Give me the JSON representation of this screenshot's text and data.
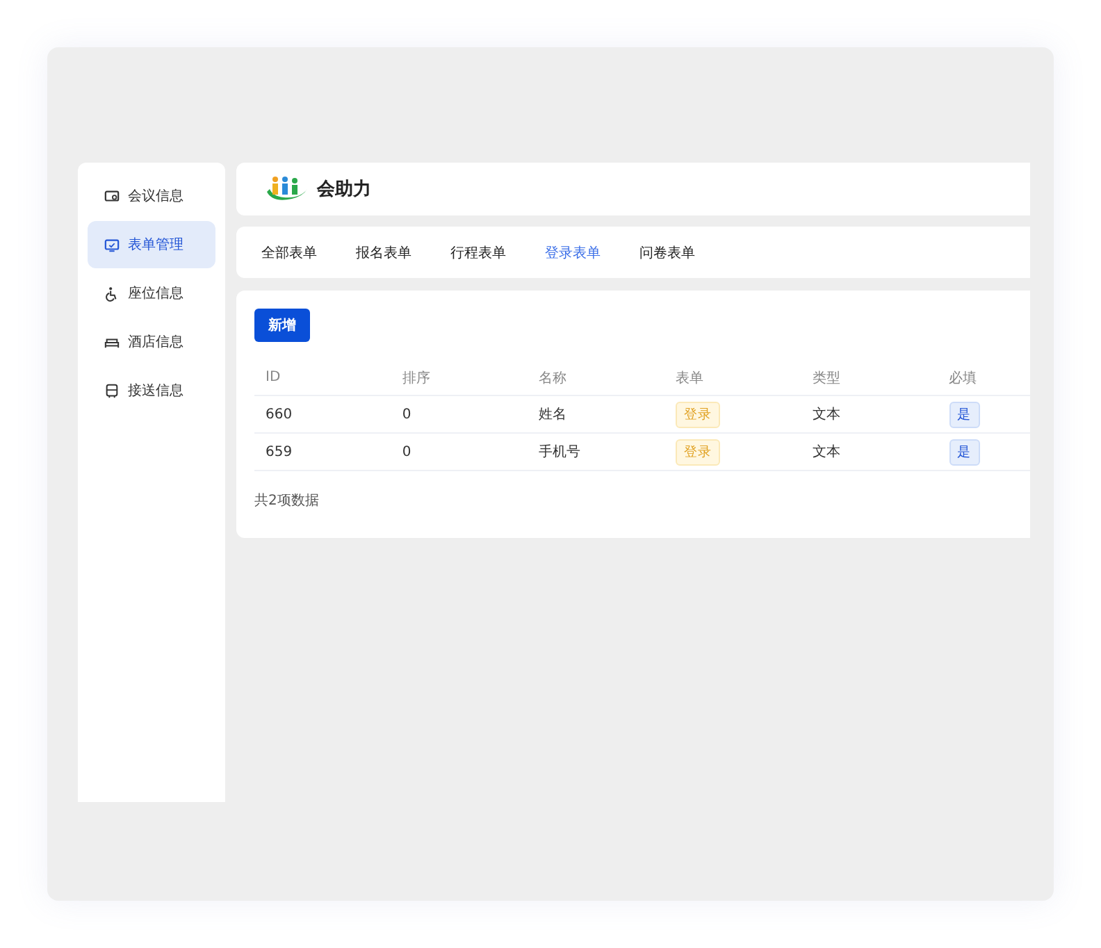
{
  "sidebar": {
    "items": [
      {
        "label": "会议信息",
        "selected": false
      },
      {
        "label": "表单管理",
        "selected": true
      },
      {
        "label": "座位信息",
        "selected": false
      },
      {
        "label": "酒店信息",
        "selected": false
      },
      {
        "label": "接送信息",
        "selected": false
      }
    ]
  },
  "header": {
    "logo_text": "会助力"
  },
  "tabs": [
    {
      "label": "全部表单",
      "selected": false
    },
    {
      "label": "报名表单",
      "selected": false
    },
    {
      "label": "行程表单",
      "selected": false
    },
    {
      "label": "登录表单",
      "selected": true
    },
    {
      "label": "问卷表单",
      "selected": false
    }
  ],
  "add_button": "新增",
  "table": {
    "columns": [
      "ID",
      "排序",
      "名称",
      "表单",
      "类型",
      "必填"
    ],
    "rows": [
      {
        "id": "660",
        "order": "0",
        "name": "姓名",
        "form": "登录",
        "type": "文本",
        "required": "是"
      },
      {
        "id": "659",
        "order": "0",
        "name": "手机号",
        "form": "登录",
        "type": "文本",
        "required": "是"
      }
    ]
  },
  "footer": "共2项数据"
}
